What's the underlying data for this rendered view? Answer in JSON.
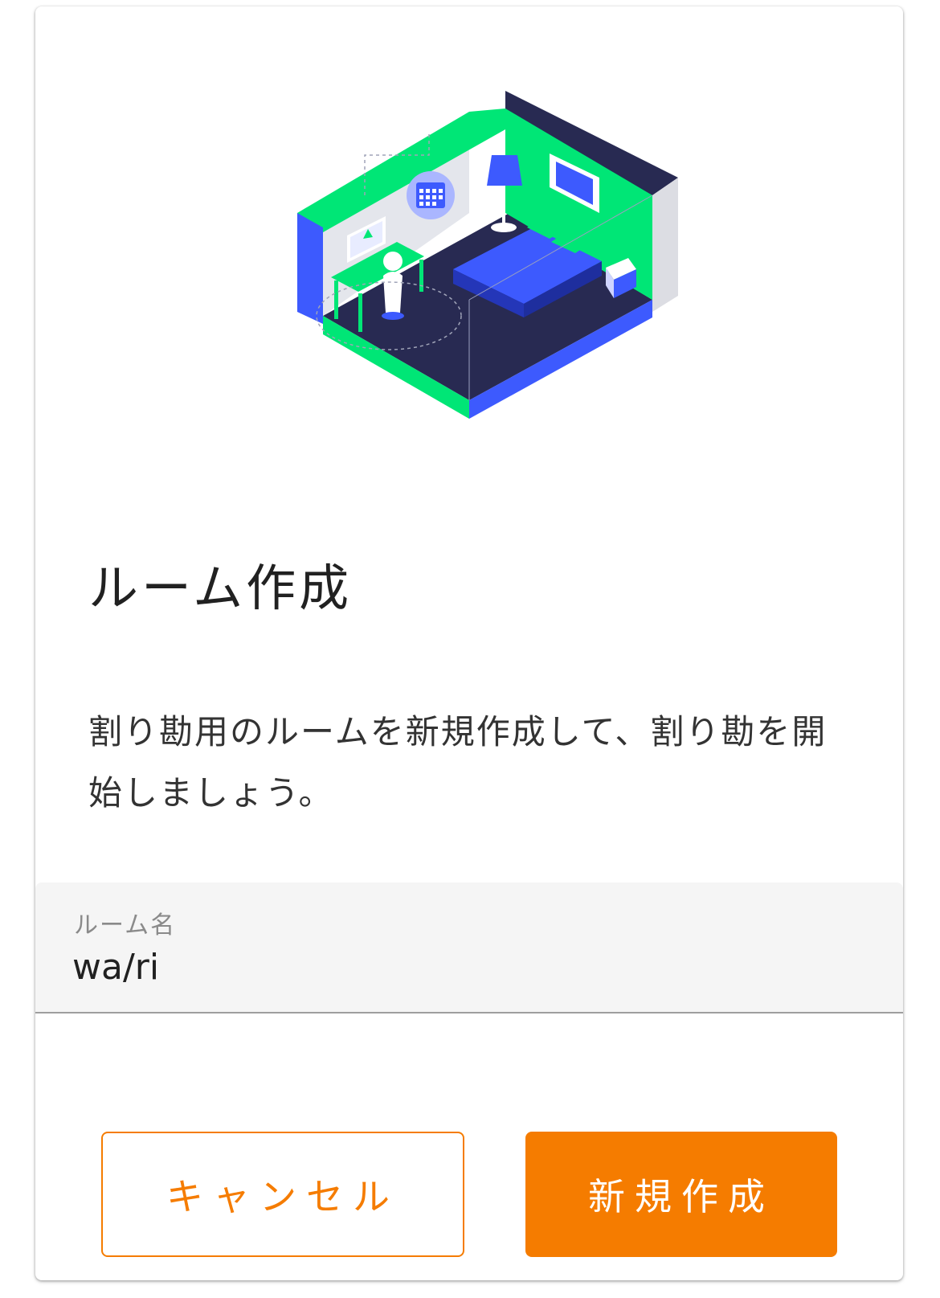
{
  "dialog": {
    "title": "ルーム作成",
    "description": "割り勘用のルームを新規作成して、割り勘を開始しましょう。"
  },
  "room_name_field": {
    "label": "ルーム名",
    "value": "wa/ri"
  },
  "actions": {
    "cancel_label": "キャンセル",
    "create_label": "新規作成"
  },
  "colors": {
    "accent": "#f57c00",
    "illustration_green": "#00e676",
    "illustration_blue": "#3d5afe",
    "illustration_navy": "#282a52"
  },
  "illustration": "isometric-room-illustration"
}
